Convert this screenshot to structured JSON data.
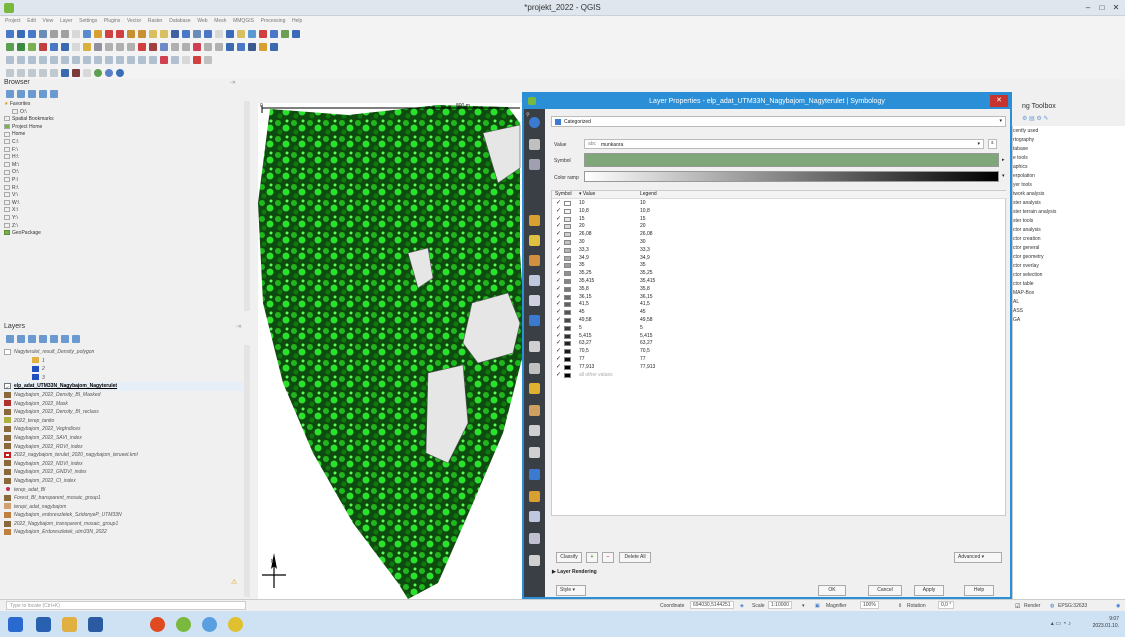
{
  "window": {
    "title": "*projekt_2022 - QGIS",
    "controls": [
      "–",
      "□",
      "✕"
    ]
  },
  "menu": [
    "Project",
    "Edit",
    "View",
    "Layer",
    "Settings",
    "Plugins",
    "Vector",
    "Raster",
    "Database",
    "Web",
    "Mesh",
    "MMQGIS",
    "Processing",
    "Help"
  ],
  "browser": {
    "title": "Browser",
    "items": [
      "Favorites",
      "O:\\",
      "Spatial Bookmarks",
      "Project Home",
      "Home",
      "C:\\",
      "F:\\",
      "H:\\",
      "M:\\",
      "O:\\",
      "P:\\",
      "R:\\",
      "V:\\",
      "W:\\",
      "X:\\",
      "Y:\\",
      "Z:\\",
      "GeoPackage"
    ]
  },
  "layers": {
    "title": "Layers",
    "items": [
      {
        "label": "Nagyterulet_result_Density_polygon",
        "color": ""
      },
      {
        "label": "1",
        "color": "#e0b040"
      },
      {
        "label": "2",
        "color": "#2050c0"
      },
      {
        "label": "3",
        "color": "#2050c0"
      },
      {
        "label": "elp_adat_UTM33N_Nagybajom_Nagyterulet",
        "color": "",
        "active": true
      },
      {
        "label": "Nagybajom_2022_Density_BI_Masked",
        "color": "#8a6a3a"
      },
      {
        "label": "Nagybajom_2022_Mask",
        "color": "#b03030"
      },
      {
        "label": "Nagybajom_2022_Density_BI_reclass",
        "color": "#8a6a3a"
      },
      {
        "label": "2022_terep_tanito",
        "color": "#b0b040"
      },
      {
        "label": "Nagybajom_2022_VegIndices",
        "color": "#8a6a3a"
      },
      {
        "label": "Nagybajom_2022_SAVI_index",
        "color": "#8a6a3a"
      },
      {
        "label": "Nagybajom_2022_RDVI_index",
        "color": "#8a6a3a"
      },
      {
        "label": "2022_nagybajom_terulet_2020_nagybajom_terueet.kml",
        "color": "#c02020"
      },
      {
        "label": "Nagybajom_2022_NDVI_index",
        "color": "#8a6a3a"
      },
      {
        "label": "Nagybajom_2022_GNDVI_index",
        "color": "#8a6a3a"
      },
      {
        "label": "Nagybajom_2022_CI_index",
        "color": "#8a6a3a"
      },
      {
        "label": "terep_adat_BI",
        "color": "#c03050"
      },
      {
        "label": "Forest_BI_transparent_mosaic_group1",
        "color": "#8a6a3a"
      },
      {
        "label": "terepi_adat_nagybajom",
        "color": "#d0a070"
      },
      {
        "label": "Nagybajom_erdoreszletek_SzidonyeP_UTM33N",
        "color": "#c08040"
      },
      {
        "label": "2022_Nagybajom_transparent_mosaic_group1",
        "color": "#8a6a3a"
      },
      {
        "label": "Nagybajom_Erdoreszletek_utm33N_2022",
        "color": "#c08040"
      }
    ]
  },
  "map": {
    "scalebar_left": "0",
    "scalebar_right": "800 m",
    "north_label": "N"
  },
  "dialog": {
    "title": "Layer Properties - elp_adat_UTM33N_Nagybajom_Nagyterulet | Symbology",
    "renderer": "Categorized",
    "value_label": "Value",
    "value_field": "munkaora",
    "symbol_label": "Symbol",
    "symbol_color": "#7fa77a",
    "ramp_label": "Color ramp",
    "columns": [
      "Symbol",
      "Value",
      "Legend"
    ],
    "rows": [
      "10",
      "10,8",
      "15",
      "20",
      "26,08",
      "30",
      "33,3",
      "34,9",
      "35",
      "35,25",
      "35,415",
      "35,8",
      "36,15",
      "41,5",
      "45",
      "49,58",
      "5",
      "5,415",
      "63,27",
      "70,5",
      "77",
      "77,913"
    ],
    "other_values": "all other values",
    "buttons": {
      "classify": "Classify",
      "delete_all": "Delete All",
      "advanced": "Advanced",
      "style": "Style",
      "ok": "OK",
      "cancel": "Cancel",
      "apply": "Apply",
      "help": "Help"
    },
    "layer_rendering": "Layer Rendering"
  },
  "toolbox": {
    "title": "ng Toolbox",
    "items": [
      "cently used",
      "rtography",
      "tabase",
      "e tools",
      "aphics",
      "erpolation",
      "yer tools",
      "twork analysis",
      "ster analysis",
      "ster terrain analysis",
      "ster tools",
      "ctor analysis",
      "ctor creation",
      "ctor general",
      "ctor geometry",
      "ctor overlay",
      "ctor selection",
      "ctor table",
      "MAP-Box",
      "AL",
      "ASS",
      "GA"
    ]
  },
  "status": {
    "locator": "Type to locate (Ctrl+K)",
    "coordinate_label": "Coordinate",
    "coordinate": "694030,5144251",
    "scale_label": "Scale",
    "scale": "1:10000",
    "magnifier_label": "Magnifier",
    "magnifier": "100%",
    "rotation_label": "Rotation",
    "rotation": "0,0 °",
    "render": "Render",
    "crs": "EPSG:32633"
  },
  "clock": {
    "time": "9:07",
    "date": "2023.01.10."
  }
}
